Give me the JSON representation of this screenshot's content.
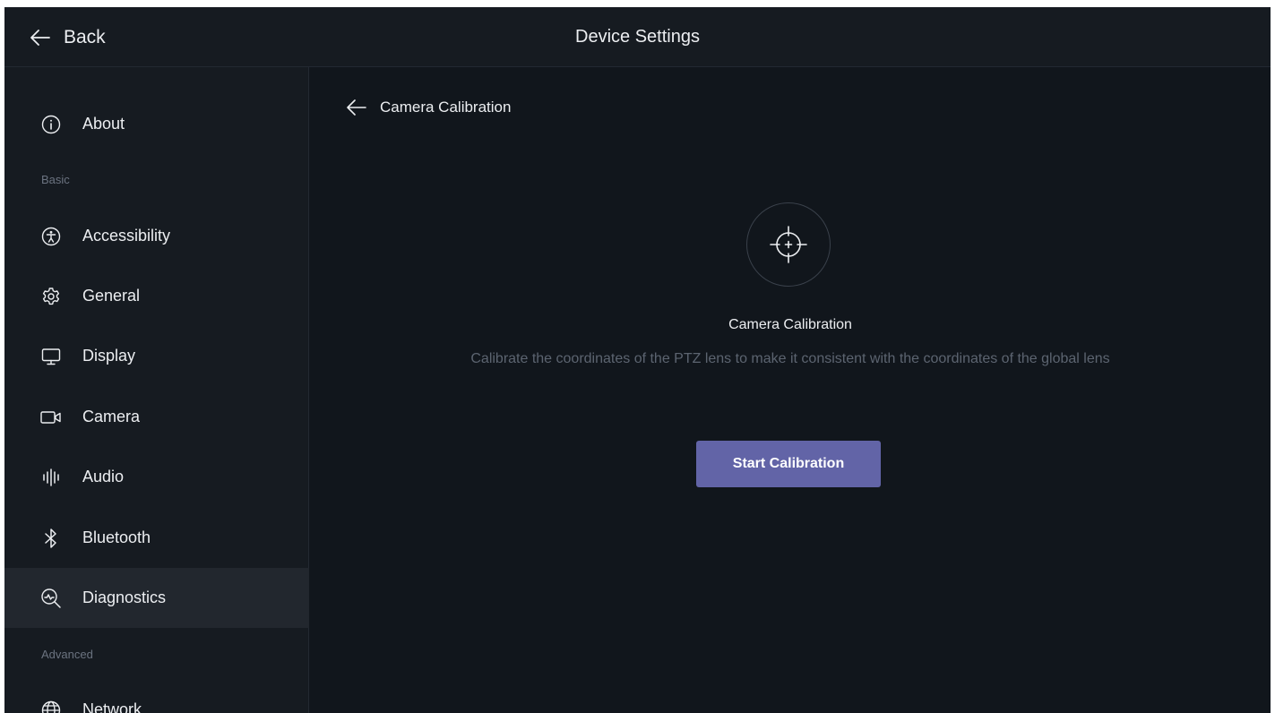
{
  "header": {
    "back_label": "Back",
    "title": "Device Settings"
  },
  "sidebar": {
    "items": [
      {
        "label": "About",
        "icon": "info-icon",
        "active": false
      },
      {
        "section": "Basic"
      },
      {
        "label": "Accessibility",
        "icon": "accessibility-icon",
        "active": false
      },
      {
        "label": "General",
        "icon": "gear-icon",
        "active": false
      },
      {
        "label": "Display",
        "icon": "monitor-icon",
        "active": false
      },
      {
        "label": "Camera",
        "icon": "camera-icon",
        "active": false
      },
      {
        "label": "Audio",
        "icon": "audio-icon",
        "active": false
      },
      {
        "label": "Bluetooth",
        "icon": "bluetooth-icon",
        "active": false
      },
      {
        "label": "Diagnostics",
        "icon": "diagnostics-icon",
        "active": true
      },
      {
        "section": "Advanced"
      },
      {
        "label": "Network",
        "icon": "globe-icon",
        "active": false
      }
    ]
  },
  "main": {
    "back_label": "Camera Calibration",
    "icon": "crosshair-icon",
    "title": "Camera Calibration",
    "description": "Calibrate the coordinates of the PTZ lens to make it consistent with the coordinates of the global lens",
    "button_label": "Start Calibration"
  },
  "colors": {
    "background": "#11161c",
    "sidebar": "#161b21",
    "active_item": "#22272e",
    "accent": "#6264a7",
    "muted_text": "#5c6470"
  }
}
